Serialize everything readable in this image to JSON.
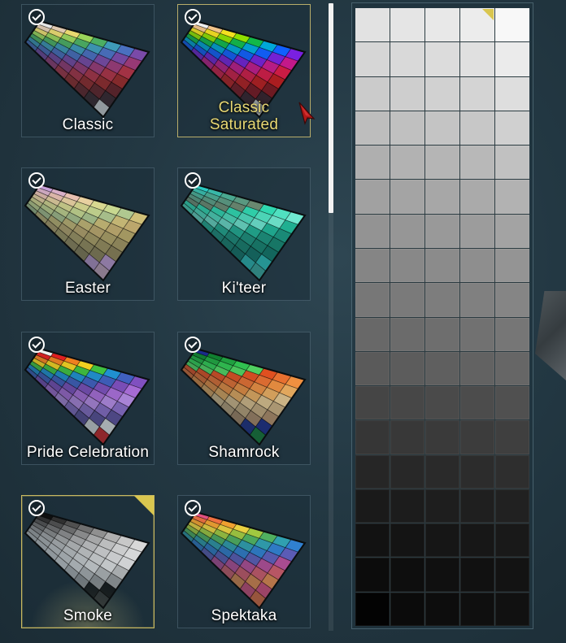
{
  "palettes": [
    {
      "name": "Classic",
      "owned": true,
      "selected": false,
      "hovered": false
    },
    {
      "name": "Classic\nSaturated",
      "owned": true,
      "selected": false,
      "hovered": true
    },
    {
      "name": "Easter",
      "owned": true,
      "selected": false,
      "hovered": false
    },
    {
      "name": "Ki'teer",
      "owned": true,
      "selected": false,
      "hovered": false
    },
    {
      "name": "Pride Celebration",
      "owned": true,
      "selected": false,
      "hovered": false
    },
    {
      "name": "Shamrock",
      "owned": true,
      "selected": false,
      "hovered": false
    },
    {
      "name": "Smoke",
      "owned": true,
      "selected": true,
      "hovered": false
    },
    {
      "name": "Spektaka",
      "owned": true,
      "selected": false,
      "hovered": false
    }
  ],
  "swatch_colors": {
    "classic": [
      "#e6e6e6",
      "#e0c9b0",
      "#e8d870",
      "#9ad45a",
      "#4cae62",
      "#3e9ab8",
      "#4a70c0",
      "#7a4aa8",
      "#a03a7a",
      "#b83246",
      "#a02828",
      "#6a1f24",
      "#3a2228"
    ],
    "classic_saturated": [
      "#f0f0f0",
      "#f2c48a",
      "#f5e020",
      "#8fe000",
      "#12b84a",
      "#00a8d8",
      "#1060ff",
      "#7a20e0",
      "#d01890",
      "#e81846",
      "#d01818",
      "#8a1018",
      "#3a1a22"
    ],
    "easter": [
      "#c9a0d8",
      "#d9b0c8",
      "#e8c0b0",
      "#e8d0a0",
      "#d8d890",
      "#c8d890",
      "#b0c890",
      "#d0c078",
      "#c8b070",
      "#b8a868",
      "#a89860",
      "#988858"
    ],
    "kiteer": [
      "#2ac8c0",
      "#38b8a8",
      "#4aa890",
      "#5a9880",
      "#6a8870",
      "#30d8b0",
      "#50e0c0",
      "#70e8d0",
      "#20b898",
      "#1a9880",
      "#148870",
      "#0e7868"
    ],
    "pride": [
      "#f0f0f0",
      "#e02020",
      "#f08020",
      "#f0d020",
      "#40c040",
      "#2090d0",
      "#4060c0",
      "#8050c0",
      "#b070e0",
      "#c090f0",
      "#9070d0",
      "#6050a0"
    ],
    "shamrock": [
      "#1a2a8a",
      "#108030",
      "#20a040",
      "#30c050",
      "#50d060",
      "#e05020",
      "#e87030",
      "#f09040",
      "#f0b060",
      "#e8c890",
      "#d0b080",
      "#b89068"
    ],
    "smoke": [
      "#101010",
      "#303030",
      "#505050",
      "#707070",
      "#909090",
      "#b0b0b0",
      "#c8c8c8",
      "#d8d8d8",
      "#e4e4e4",
      "#eeeeee",
      "#cccccc",
      "#a8a8a8"
    ],
    "spektaka": [
      "#e05080",
      "#f07040",
      "#f0a030",
      "#e8d040",
      "#a0c840",
      "#50b060",
      "#30a0b0",
      "#3080d0",
      "#6060c0",
      "#c050a0",
      "#e06070",
      "#f09050"
    ]
  },
  "grayscale_columns": 5,
  "grayscale_rows": [
    [
      "#e2e2e2",
      "#e5e5e5",
      "#e8e8e8",
      "#ececec",
      "#f8f8f8"
    ],
    [
      "#d6d6d6",
      "#d9d9d9",
      "#dcdcdc",
      "#e0e0e0",
      "#ebebeb"
    ],
    [
      "#cbcbcb",
      "#cecece",
      "#d1d1d1",
      "#d4d4d4",
      "#dedede"
    ],
    [
      "#bdbdbd",
      "#c0c0c0",
      "#c4c4c4",
      "#c7c7c7",
      "#d0d0d0"
    ],
    [
      "#afafaf",
      "#b2b2b2",
      "#b5b5b5",
      "#b8b8b8",
      "#c1c1c1"
    ],
    [
      "#a1a1a1",
      "#a4a4a4",
      "#a7a7a7",
      "#aaaaaa",
      "#b2b2b2"
    ],
    [
      "#939393",
      "#969696",
      "#999999",
      "#9c9c9c",
      "#a3a3a3"
    ],
    [
      "#858585",
      "#888888",
      "#8b8b8b",
      "#8e8e8e",
      "#949494"
    ],
    [
      "#777777",
      "#7a7a7a",
      "#7d7d7d",
      "#808080",
      "#858585"
    ],
    [
      "#686868",
      "#6b6b6b",
      "#6e6e6e",
      "#717171",
      "#767676"
    ],
    [
      "#5a5a5a",
      "#5c5c5c",
      "#5f5f5f",
      "#626262",
      "#666666"
    ],
    [
      "#454545",
      "#474747",
      "#4a4a4a",
      "#4c4c4c",
      "#505050"
    ],
    [
      "#363636",
      "#383838",
      "#3a3a3a",
      "#3c3c3c",
      "#3f3f3f"
    ],
    [
      "#262626",
      "#282828",
      "#2a2a2a",
      "#2c2c2c",
      "#2e2e2e"
    ],
    [
      "#1a1a1a",
      "#1c1c1c",
      "#1e1e1e",
      "#1f1f1f",
      "#212121"
    ],
    [
      "#121212",
      "#141414",
      "#161616",
      "#171717",
      "#191919"
    ],
    [
      "#0c0c0c",
      "#0e0e0e",
      "#101010",
      "#111111",
      "#131313"
    ],
    [
      "#030303",
      "#0b0b0b",
      "#0d0d0d",
      "#0f0f0f",
      "#111111"
    ]
  ],
  "active_color": {
    "row": 0,
    "col": 3
  },
  "accent_color": "#d9c64f",
  "icons": {
    "owned": "check-circle-icon",
    "cursor": "pointer-cursor-icon"
  }
}
